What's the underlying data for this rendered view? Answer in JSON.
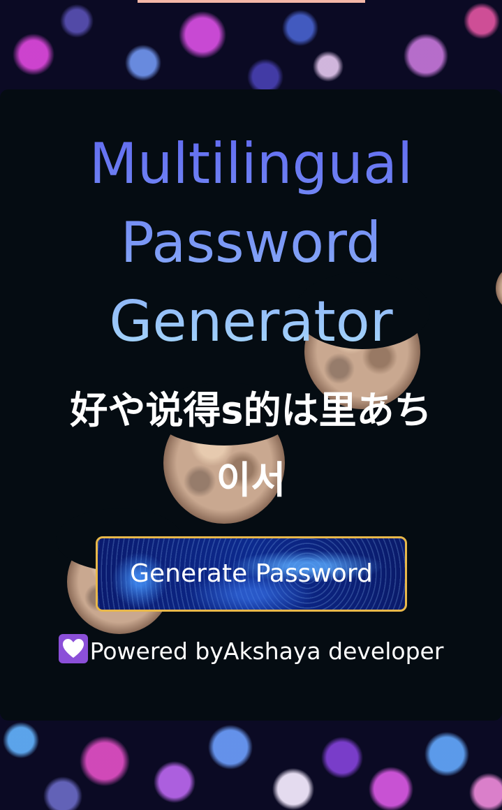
{
  "app": {
    "title_lines": [
      "Multilingual",
      "Password",
      "Generator"
    ]
  },
  "generated": {
    "password_line1": "好や说得s的は里あち",
    "password_line2": "이서"
  },
  "actions": {
    "generate_label": "Generate Password"
  },
  "footer": {
    "icon": "heart-icon",
    "text": "Powered byAkshaya developer"
  },
  "colors": {
    "title_gradient_top": "#6068f0",
    "title_gradient_bottom": "#a9dcfb",
    "button_border": "#e8b84a",
    "card_background": "#050c12",
    "heart_badge": "#8b4fd8"
  }
}
